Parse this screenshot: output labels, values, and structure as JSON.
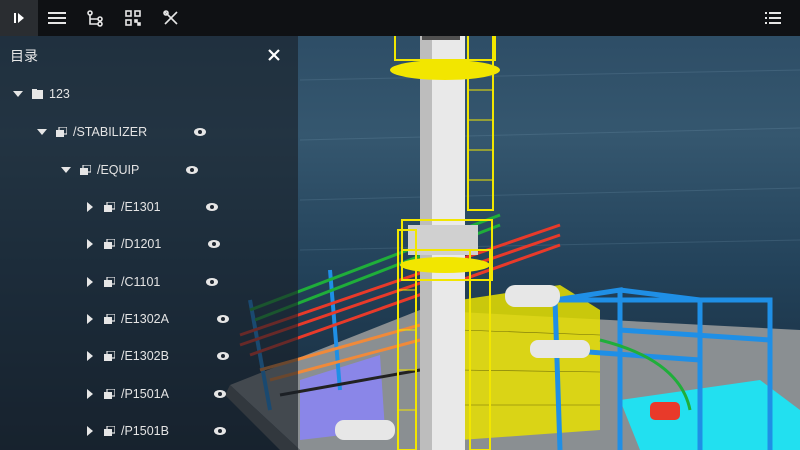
{
  "panel": {
    "title": "目录",
    "tree": [
      {
        "label": "123",
        "expanded": true,
        "icon": "folder-icon"
      },
      {
        "label": "/STABILIZER",
        "expanded": true,
        "icon": "component-icon"
      },
      {
        "label": "/EQUIP",
        "expanded": true,
        "icon": "component-icon"
      },
      {
        "label": "/E1301",
        "expanded": false,
        "icon": "component-icon"
      },
      {
        "label": "/D1201",
        "expanded": false,
        "icon": "component-icon"
      },
      {
        "label": "/C1101",
        "expanded": false,
        "icon": "component-icon"
      },
      {
        "label": "/E1302A",
        "expanded": false,
        "icon": "component-icon"
      },
      {
        "label": "/E1302B",
        "expanded": false,
        "icon": "component-icon"
      },
      {
        "label": "/P1501A",
        "expanded": false,
        "icon": "component-icon"
      },
      {
        "label": "/P1501B",
        "expanded": false,
        "icon": "component-icon"
      }
    ]
  },
  "toolbar": {
    "buttons": [
      "play-icon",
      "menu-icon",
      "tree-structure-icon",
      "qr-scan-icon",
      "measure-tools-icon"
    ],
    "right_button": "list-icon"
  },
  "colors": {
    "toolbar_bg": "#0f1114",
    "structure_yellow": "#f2e600",
    "steel_blue": "#1f8fe6",
    "pipe_red": "#e83a2a",
    "pipe_green": "#1fae3a",
    "cyan_platform": "#22e0f0",
    "panel_bg": "rgba(24,30,38,0.62)"
  }
}
